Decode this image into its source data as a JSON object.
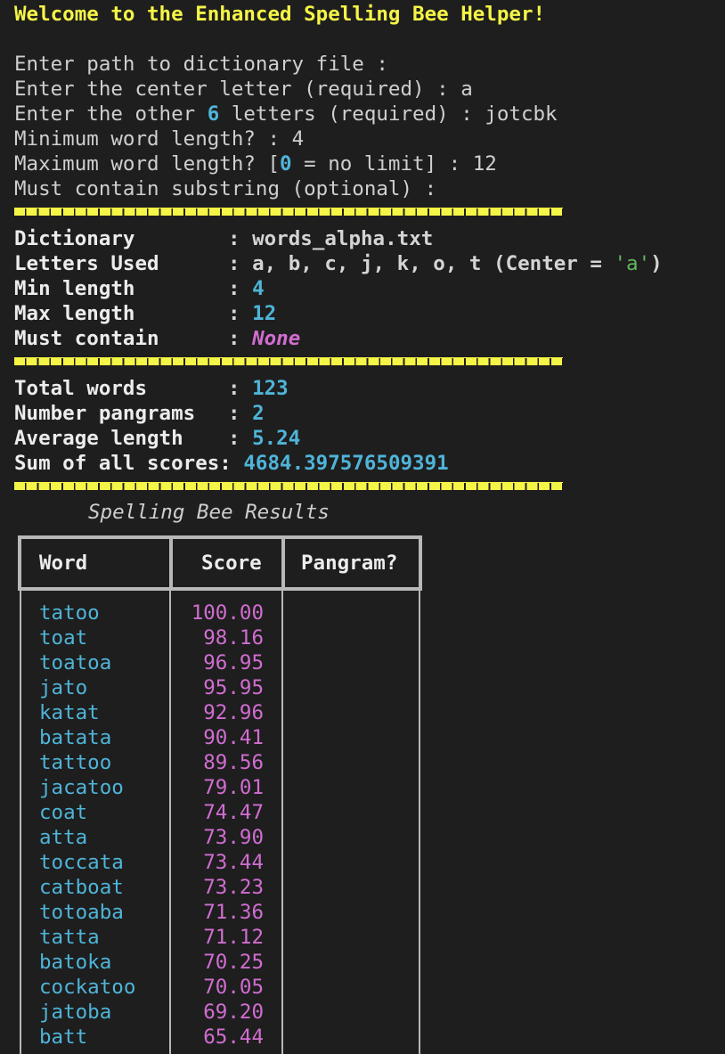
{
  "welcome": "Welcome to the Enhanced Spelling Bee Helper!",
  "prompts": {
    "dict_label": "Enter path to dictionary file :",
    "dict_value": "",
    "center_label": "Enter the center letter (required) :",
    "center_value": "a",
    "other_label_pre": "Enter the other ",
    "other_count": "6",
    "other_label_post": " letters (required) :",
    "other_value": "jotcbk",
    "min_label": "Minimum word length? :",
    "min_value": "4",
    "max_label_pre": "Maximum word length? [",
    "max_zero": "0",
    "max_label_post": " = no limit] :",
    "max_value": "12",
    "substr_label": "Must contain substring (optional) :",
    "substr_value": ""
  },
  "config": {
    "dictionary_key": "Dictionary",
    "dictionary_value": "words_alpha.txt",
    "letters_key": "Letters Used",
    "letters_value": "a, b, c, j, k, o, t (Center = ",
    "center_quoted": "'a'",
    "letters_close": ")",
    "min_key": "Min length",
    "min_value": "4",
    "max_key": "Max length",
    "max_value": "12",
    "contain_key": "Must contain",
    "contain_value": "None"
  },
  "stats": {
    "total_key": "Total words",
    "total_value": "123",
    "pangram_key": "Number pangrams",
    "pangram_value": "2",
    "avg_key": "Average length",
    "avg_value": "5.24",
    "sum_key": "Sum of all scores:",
    "sum_value": "4684.397576509391"
  },
  "colon": ":",
  "results": {
    "title": "Spelling Bee Results",
    "columns": [
      "Word",
      "Score",
      "Pangram?"
    ],
    "rows": [
      {
        "word": "tatoo",
        "score": "100.00",
        "pangram": ""
      },
      {
        "word": "toat",
        "score": "98.16",
        "pangram": ""
      },
      {
        "word": "toatoa",
        "score": "96.95",
        "pangram": ""
      },
      {
        "word": "jato",
        "score": "95.95",
        "pangram": ""
      },
      {
        "word": "katat",
        "score": "92.96",
        "pangram": ""
      },
      {
        "word": "batata",
        "score": "90.41",
        "pangram": ""
      },
      {
        "word": "tattoo",
        "score": "89.56",
        "pangram": ""
      },
      {
        "word": "jacatoo",
        "score": "79.01",
        "pangram": ""
      },
      {
        "word": "coat",
        "score": "74.47",
        "pangram": ""
      },
      {
        "word": "atta",
        "score": "73.90",
        "pangram": ""
      },
      {
        "word": "toccata",
        "score": "73.44",
        "pangram": ""
      },
      {
        "word": "catboat",
        "score": "73.23",
        "pangram": ""
      },
      {
        "word": "totoaba",
        "score": "71.36",
        "pangram": ""
      },
      {
        "word": "tatta",
        "score": "71.12",
        "pangram": ""
      },
      {
        "word": "batoka",
        "score": "70.25",
        "pangram": ""
      },
      {
        "word": "cockatoo",
        "score": "70.05",
        "pangram": ""
      },
      {
        "word": "jatoba",
        "score": "69.20",
        "pangram": ""
      },
      {
        "word": "batt",
        "score": "65.44",
        "pangram": ""
      }
    ]
  }
}
